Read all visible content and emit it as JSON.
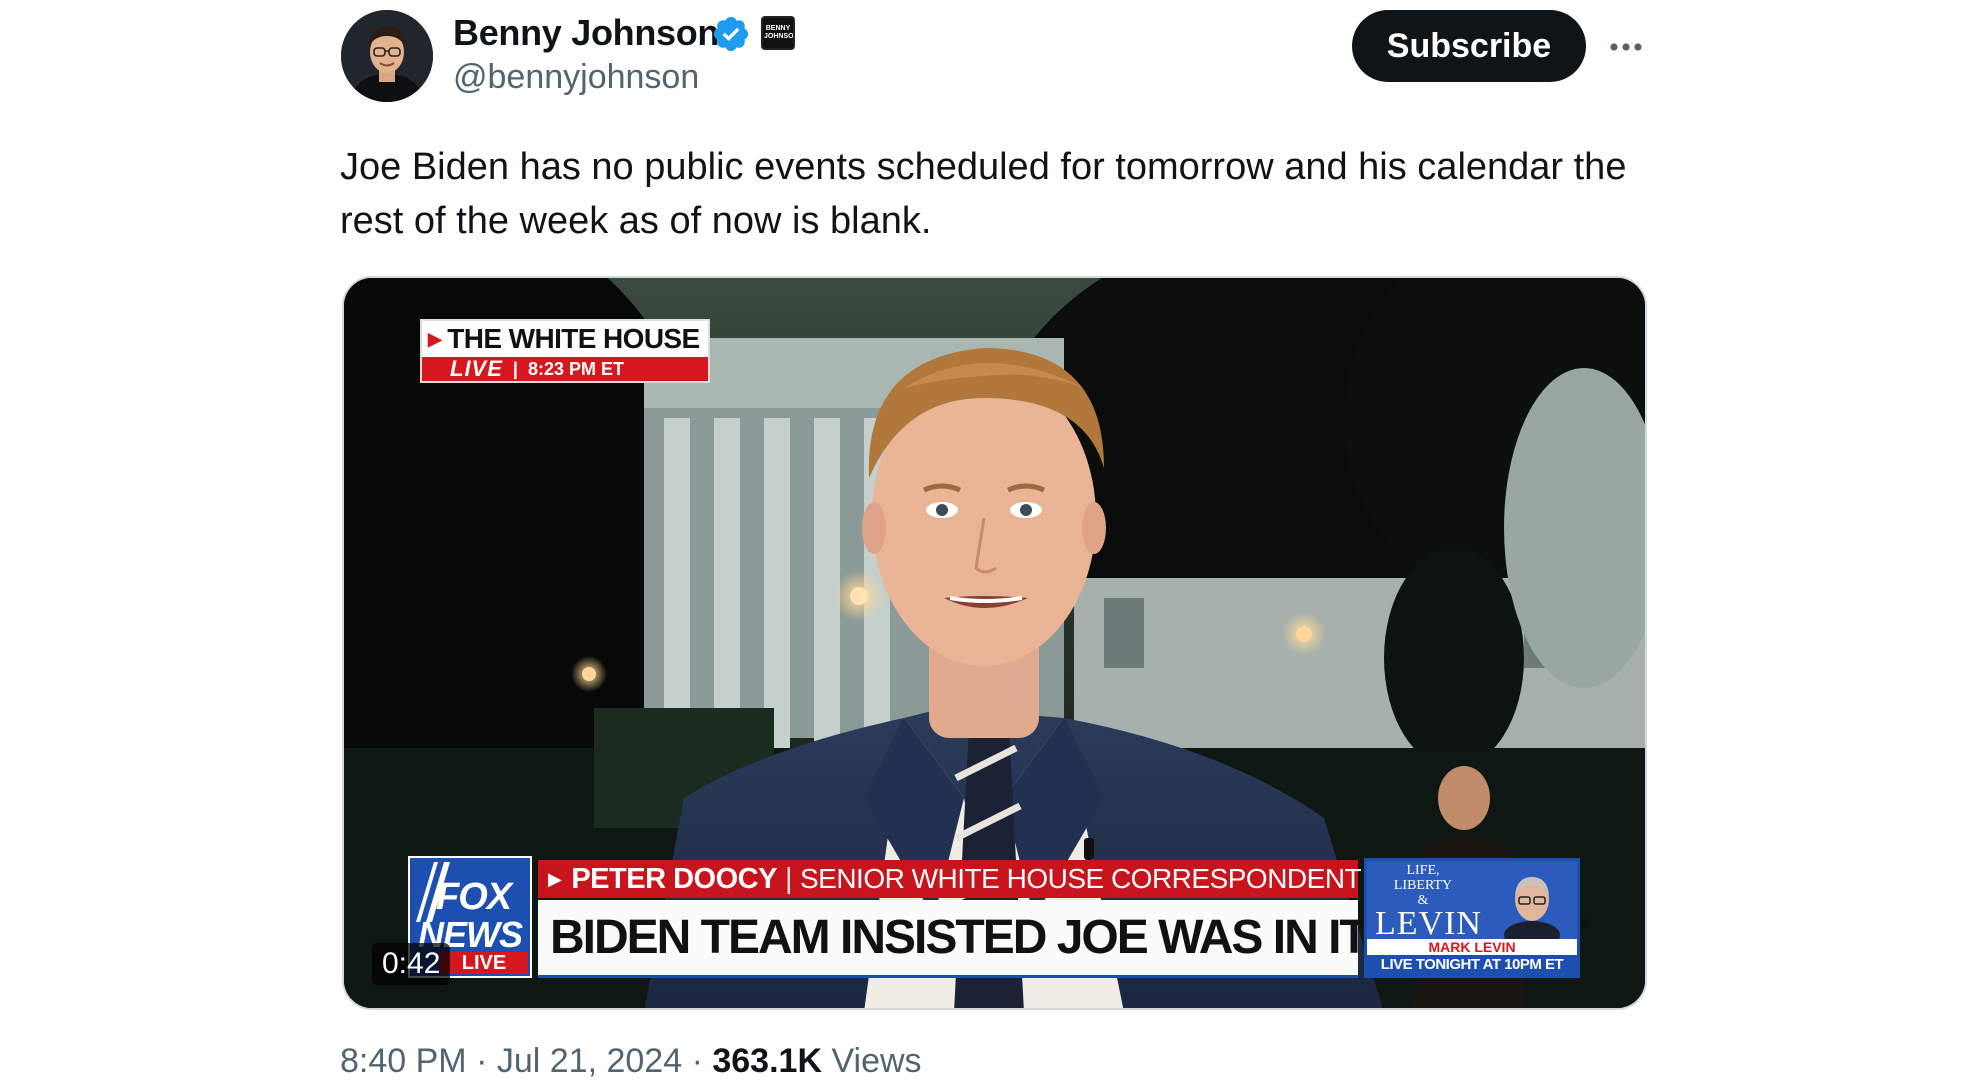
{
  "author": {
    "name": "Benny Johnson",
    "handle": "@bennyjohnson",
    "verified_icon": "verified-badge-icon",
    "affiliate_badge_text": "BENNY JOHNSON"
  },
  "actions": {
    "subscribe_label": "Subscribe",
    "more_icon": "more-horizontal-icon"
  },
  "tweet": {
    "text": "Joe Biden has no public events scheduled for tomorrow and his calendar the rest of the week as of now is blank."
  },
  "video": {
    "duration": "0:42",
    "bug": {
      "location": "THE WHITE HOUSE",
      "live": "LIVE",
      "time": "8:23 PM ET"
    },
    "chyron": {
      "name": "PETER DOOCY",
      "title": "SENIOR WHITE HOUSE CORRESPONDENT",
      "headline": "BIDEN TEAM INSISTED JOE WAS IN IT TO WIN IT"
    },
    "network_logo": {
      "line1": "FOX",
      "line2": "NEWS",
      "line3": "LIVE"
    },
    "promo": {
      "show_top": "LIFE,\nLIBERTY\n& ",
      "show_name": "LEVIN",
      "host": "MARK LEVIN",
      "tune_in": "LIVE TONIGHT AT 10PM ET"
    }
  },
  "meta": {
    "time": "8:40 PM",
    "date": "Jul 21, 2024",
    "views_count": "363.1K",
    "views_label": "Views",
    "separator": "·"
  },
  "colors": {
    "subscribe_bg": "#0f1419",
    "verified": "#1d9bf0",
    "secondary_text": "#536471",
    "fox_red": "#d6171d",
    "fox_blue": "#1d4fb0"
  }
}
